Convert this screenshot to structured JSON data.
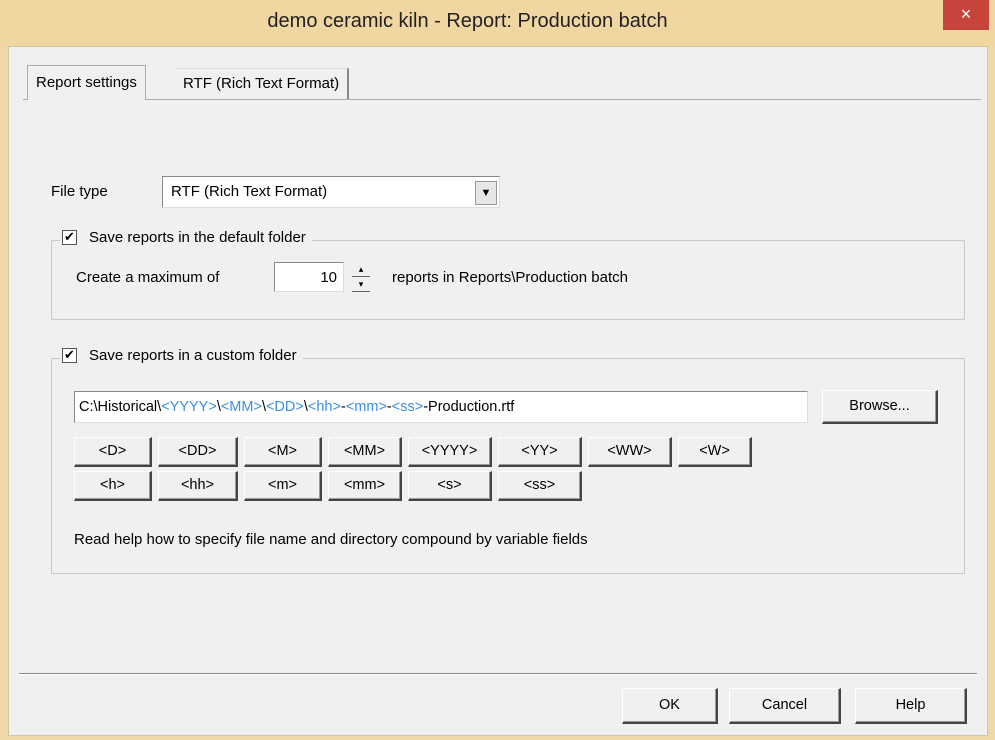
{
  "window": {
    "title": "demo ceramic kiln - Report: Production batch",
    "close_glyph": "×"
  },
  "tabs": [
    {
      "label": "Report settings",
      "active": true
    },
    {
      "label": "RTF (Rich Text Format)",
      "active": false
    }
  ],
  "file_type": {
    "label": "File type",
    "value": "RTF (Rich Text Format)",
    "arrow": "▼"
  },
  "default_folder": {
    "checkbox_label": "Save reports in the default folder",
    "checked": true,
    "check_glyph": "✔",
    "max_prefix": "Create a maximum of",
    "max_value": "10",
    "spin_up": "▴",
    "spin_down": "▾",
    "max_suffix": "reports in Reports\\Production batch"
  },
  "custom_folder": {
    "checkbox_label": "Save reports in a custom folder",
    "checked": true,
    "check_glyph": "✔",
    "path_parts": [
      {
        "text": "C:\\Historical\\",
        "var": false
      },
      {
        "text": "<YYYY>",
        "var": true
      },
      {
        "text": "\\",
        "var": false
      },
      {
        "text": "<MM>",
        "var": true
      },
      {
        "text": "\\",
        "var": false
      },
      {
        "text": "<DD>",
        "var": true
      },
      {
        "text": "\\",
        "var": false
      },
      {
        "text": "<hh>",
        "var": true
      },
      {
        "text": "-",
        "var": false
      },
      {
        "text": "<mm>",
        "var": true
      },
      {
        "text": "-",
        "var": false
      },
      {
        "text": "<ss>",
        "var": true
      },
      {
        "text": "-Production.rtf",
        "var": false
      }
    ],
    "browse_label": "Browse...",
    "var_buttons_row1": [
      "<D>",
      "<DD>",
      "<M>",
      "<MM>",
      "<YYYY>",
      "<YY>",
      "<WW>",
      "<W>"
    ],
    "var_buttons_row2": [
      "<h>",
      "<hh>",
      "<m>",
      "<mm>",
      "<s>",
      "<ss>"
    ],
    "help_text": "Read help how to specify file name and directory compound by variable fields"
  },
  "footer": {
    "ok_label": "OK",
    "cancel_label": "Cancel",
    "help_label": "Help"
  }
}
